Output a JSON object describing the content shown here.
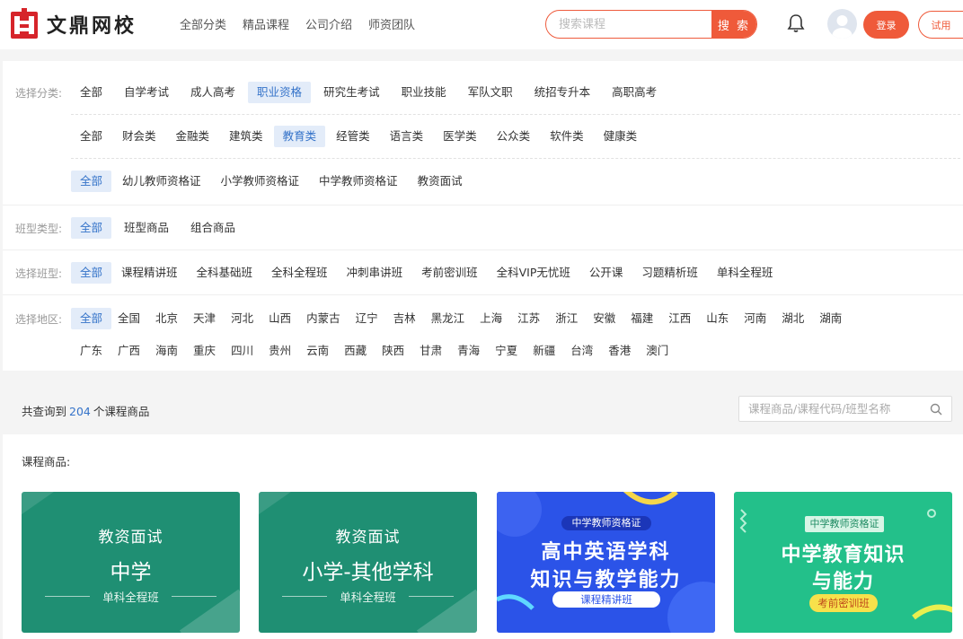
{
  "header": {
    "logo_text": "文鼎网校",
    "nav": [
      "全部分类",
      "精品课程",
      "公司介绍",
      "师资团队"
    ],
    "search_placeholder": "搜索课程",
    "search_button": "搜 索",
    "login": "登录",
    "trial": "试用"
  },
  "filters": {
    "category_label": "选择分类:",
    "category_row1": [
      "全部",
      "自学考试",
      "成人高考",
      "职业资格",
      "研究生考试",
      "职业技能",
      "军队文职",
      "统招专升本",
      "高职高考"
    ],
    "category_row1_selected": 3,
    "category_row2": [
      "全部",
      "财会类",
      "金融类",
      "建筑类",
      "教育类",
      "经管类",
      "语言类",
      "医学类",
      "公众类",
      "软件类",
      "健康类"
    ],
    "category_row2_selected": 4,
    "category_row3": [
      "全部",
      "幼儿教师资格证",
      "小学教师资格证",
      "中学教师资格证",
      "教资面试"
    ],
    "category_row3_selected": 0,
    "class_type_label": "班型类型:",
    "class_type": [
      "全部",
      "班型商品",
      "组合商品"
    ],
    "class_label": "选择班型:",
    "class": [
      "全部",
      "课程精讲班",
      "全科基础班",
      "全科全程班",
      "冲刺串讲班",
      "考前密训班",
      "全科VIP无忧班",
      "公开课",
      "习题精析班",
      "单科全程班"
    ],
    "region_label": "选择地区:",
    "region_row1": [
      "全部",
      "全国",
      "北京",
      "天津",
      "河北",
      "山西",
      "内蒙古",
      "辽宁",
      "吉林",
      "黑龙江",
      "上海",
      "江苏",
      "浙江",
      "安徽",
      "福建",
      "江西",
      "山东",
      "河南",
      "湖北",
      "湖南"
    ],
    "region_row2": [
      "广东",
      "广西",
      "海南",
      "重庆",
      "四川",
      "贵州",
      "云南",
      "西藏",
      "陕西",
      "甘肃",
      "青海",
      "宁夏",
      "新疆",
      "台湾",
      "香港",
      "澳门"
    ]
  },
  "results": {
    "prefix": "共查询到",
    "count": "204",
    "suffix": "个课程商品",
    "search_placeholder": "课程商品/课程代码/班型名称"
  },
  "courses": {
    "title": "课程商品:",
    "cards": [
      {
        "line1": "教资面试",
        "line2": "中学",
        "line3": "单科全程班"
      },
      {
        "line1": "教资面试",
        "line2": "小学-其他学科",
        "line3": "单科全程班"
      },
      {
        "tag": "中学教师资格证",
        "line1": "高中英语学科",
        "line2": "知识与教学能力",
        "line3": "课程精讲班"
      },
      {
        "tag": "中学教师资格证",
        "line1": "中学教育知识",
        "line2": "与能力",
        "line3": "考前密训班"
      }
    ]
  },
  "colors": {
    "accent": "#ef5a3a",
    "selected_bg": "#e3ecf9",
    "selected_text": "#3573c9"
  }
}
